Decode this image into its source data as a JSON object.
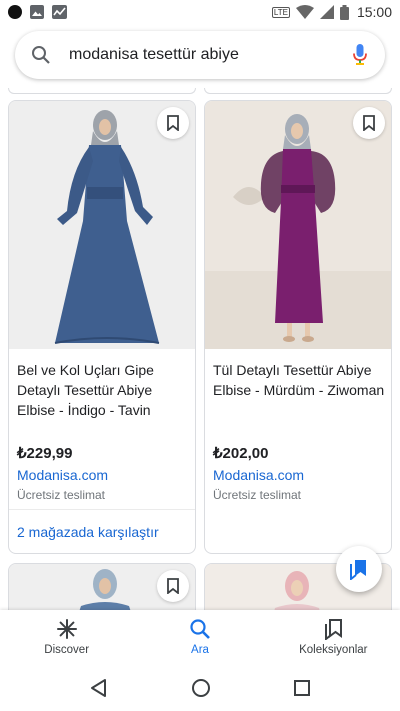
{
  "status_bar": {
    "time": "15:00",
    "network": "LTE",
    "icons": [
      "notification-dot-icon",
      "image-icon",
      "chart-icon",
      "volte-icon",
      "wifi-icon",
      "signal-icon",
      "battery-icon"
    ]
  },
  "search": {
    "query": "modanisa tesettür abiye",
    "icons": [
      "search-icon",
      "mic-icon"
    ]
  },
  "products": [
    {
      "title": "Bel ve Kol Uçları Gipe Detaylı Tesettür Abiye Elbise - İndigo - Tavin",
      "price": "₺229,99",
      "store": "Modanisa.com",
      "shipping": "Ücretsiz teslimat",
      "compare": "2 mağazada karşılaştır",
      "dress_color": "#3f5f8f"
    },
    {
      "title": "Tül Detaylı Tesettür Abiye Elbise - Mürdüm - Ziwoman",
      "price": "₺202,00",
      "store": "Modanisa.com",
      "shipping": "Ücretsiz teslimat",
      "dress_color": "#7a1f6e"
    }
  ],
  "bottom_nav": [
    {
      "label": "Discover",
      "icon": "asterisk-icon",
      "active": false
    },
    {
      "label": "Ara",
      "icon": "search-icon",
      "active": true
    },
    {
      "label": "Koleksiyonlar",
      "icon": "collections-icon",
      "active": false
    }
  ],
  "colors": {
    "accent": "#1a73e8",
    "link": "#1967d2",
    "text": "#202124",
    "muted": "#70757a"
  }
}
